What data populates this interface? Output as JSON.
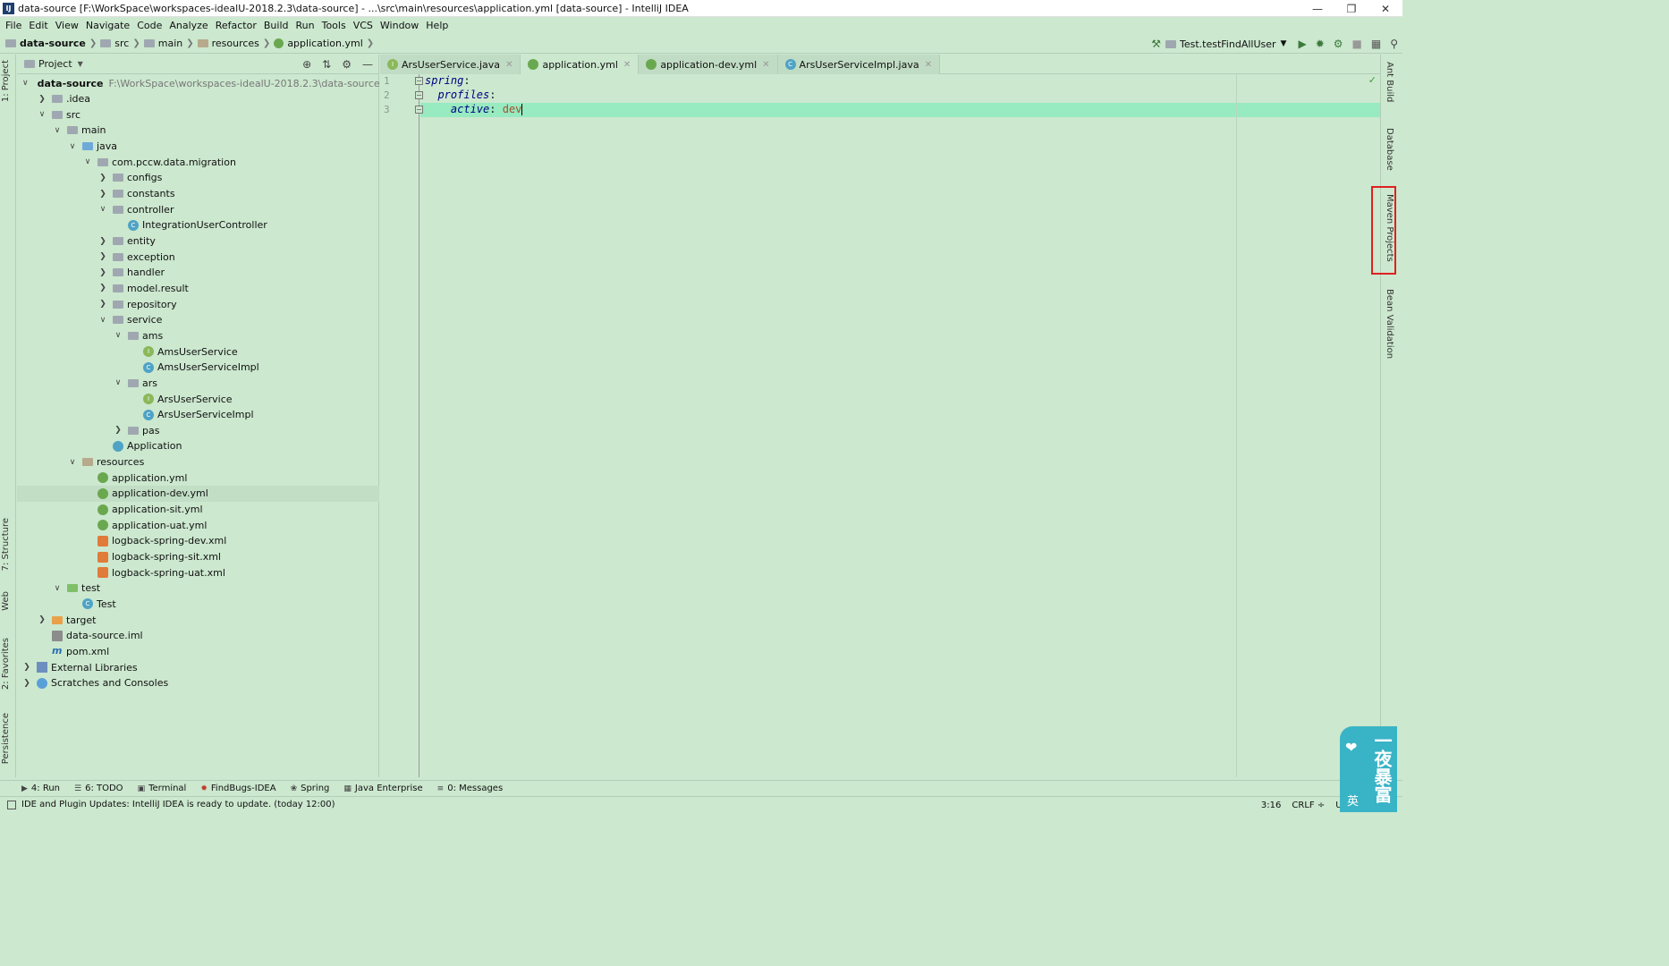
{
  "window": {
    "title": "data-source [F:\\WorkSpace\\workspaces-idealU-2018.2.3\\data-source] - ...\\src\\main\\resources\\application.yml [data-source] - IntelliJ IDEA",
    "app_icon": "IJ"
  },
  "menu": [
    "File",
    "Edit",
    "View",
    "Navigate",
    "Code",
    "Analyze",
    "Refactor",
    "Build",
    "Run",
    "Tools",
    "VCS",
    "Window",
    "Help"
  ],
  "breadcrumbs": [
    "data-source",
    "src",
    "main",
    "resources",
    "application.yml"
  ],
  "run_config": "Test.testFindAllUser",
  "left_tabs": [
    "1: Project",
    "7: Structure",
    "Web",
    "2: Favorites",
    "Persistence"
  ],
  "project_panel": {
    "title": "Project",
    "tree": [
      {
        "label": "data-source",
        "hint": "F:\\WorkSpace\\workspaces-idealU-2018.2.3\\data-source",
        "arrow": "open",
        "icon": "module",
        "bold": true
      },
      {
        "label": ".idea",
        "arrow": "closed",
        "icon": "folder"
      },
      {
        "label": "src",
        "arrow": "open",
        "icon": "folder"
      },
      {
        "label": "main",
        "arrow": "open",
        "icon": "folder"
      },
      {
        "label": "java",
        "arrow": "open",
        "icon": "folder-blue"
      },
      {
        "label": "com.pccw.data.migration",
        "arrow": "open",
        "icon": "package"
      },
      {
        "label": "configs",
        "arrow": "closed",
        "icon": "package"
      },
      {
        "label": "constants",
        "arrow": "closed",
        "icon": "package"
      },
      {
        "label": "controller",
        "arrow": "open",
        "icon": "package"
      },
      {
        "label": "IntegrationUserController",
        "arrow": "none",
        "icon": "class"
      },
      {
        "label": "entity",
        "arrow": "closed",
        "icon": "package"
      },
      {
        "label": "exception",
        "arrow": "closed",
        "icon": "package"
      },
      {
        "label": "handler",
        "arrow": "closed",
        "icon": "package"
      },
      {
        "label": "model.result",
        "arrow": "closed",
        "icon": "package"
      },
      {
        "label": "repository",
        "arrow": "closed",
        "icon": "package"
      },
      {
        "label": "service",
        "arrow": "open",
        "icon": "package"
      },
      {
        "label": "ams",
        "arrow": "open",
        "icon": "package"
      },
      {
        "label": "AmsUserService",
        "arrow": "none",
        "icon": "interface"
      },
      {
        "label": "AmsUserServiceImpl",
        "arrow": "none",
        "icon": "class"
      },
      {
        "label": "ars",
        "arrow": "open",
        "icon": "package"
      },
      {
        "label": "ArsUserService",
        "arrow": "none",
        "icon": "interface"
      },
      {
        "label": "ArsUserServiceImpl",
        "arrow": "none",
        "icon": "class"
      },
      {
        "label": "pas",
        "arrow": "closed",
        "icon": "package"
      },
      {
        "label": "Application",
        "arrow": "none",
        "icon": "app"
      },
      {
        "label": "resources",
        "arrow": "open",
        "icon": "folder-res"
      },
      {
        "label": "application.yml",
        "arrow": "none",
        "icon": "yml"
      },
      {
        "label": "application-dev.yml",
        "arrow": "none",
        "icon": "yml",
        "selected": true
      },
      {
        "label": "application-sit.yml",
        "arrow": "none",
        "icon": "yml"
      },
      {
        "label": "application-uat.yml",
        "arrow": "none",
        "icon": "yml"
      },
      {
        "label": "logback-spring-dev.xml",
        "arrow": "none",
        "icon": "xml"
      },
      {
        "label": "logback-spring-sit.xml",
        "arrow": "none",
        "icon": "xml"
      },
      {
        "label": "logback-spring-uat.xml",
        "arrow": "none",
        "icon": "xml"
      },
      {
        "label": "test",
        "arrow": "open",
        "icon": "folder-test"
      },
      {
        "label": "Test",
        "arrow": "none",
        "icon": "class"
      },
      {
        "label": "target",
        "arrow": "closed",
        "icon": "folder-orange"
      },
      {
        "label": "data-source.iml",
        "arrow": "none",
        "icon": "iml"
      },
      {
        "label": "pom.xml",
        "arrow": "none",
        "icon": "maven"
      },
      {
        "label": "External Libraries",
        "arrow": "closed",
        "icon": "lib"
      },
      {
        "label": "Scratches and Consoles",
        "arrow": "closed",
        "icon": "scratch"
      }
    ]
  },
  "tabs": [
    {
      "label": "ArsUserService.java",
      "icon": "interface",
      "active": false
    },
    {
      "label": "application.yml",
      "icon": "yml",
      "active": true
    },
    {
      "label": "application-dev.yml",
      "icon": "yml",
      "active": false
    },
    {
      "label": "ArsUserServiceImpl.java",
      "icon": "class",
      "active": false
    }
  ],
  "editor": {
    "line_numbers": [
      "1",
      "2",
      "3"
    ],
    "lines": [
      {
        "key": "spring",
        "sep": ":",
        "value": ""
      },
      {
        "key": "profiles",
        "sep": ":",
        "value": ""
      },
      {
        "key": "active",
        "sep": ": ",
        "value": "dev"
      }
    ]
  },
  "right_tabs": [
    "Ant Build",
    "Database",
    "Maven Projects",
    "Bean Validation"
  ],
  "bottom_tools": [
    {
      "label": "4: Run",
      "icon": "run-icon"
    },
    {
      "label": "6: TODO",
      "icon": "todo-icon"
    },
    {
      "label": "Terminal",
      "icon": "terminal-icon"
    },
    {
      "label": "FindBugs-IDEA",
      "icon": "bug-icon"
    },
    {
      "label": "Spring",
      "icon": "spring-icon"
    },
    {
      "label": "Java Enterprise",
      "icon": "java-ee-icon"
    },
    {
      "label": "0: Messages",
      "icon": "messages-icon"
    }
  ],
  "status": {
    "message": "IDE and Plugin Updates: IntelliJ IDEA is ready to update. (today 12:00)",
    "position": "3:16",
    "line_sep": "CRLF ÷",
    "encoding": "UTF-"
  },
  "watermark": {
    "text": "一夜暴富",
    "small": "英"
  },
  "colors": {
    "background": "#cce8cf",
    "current_line": "#98eac1",
    "key": "#000080",
    "value": "#a0522d",
    "highlight_box": "#e02020",
    "watermark": "#39b4c6"
  }
}
